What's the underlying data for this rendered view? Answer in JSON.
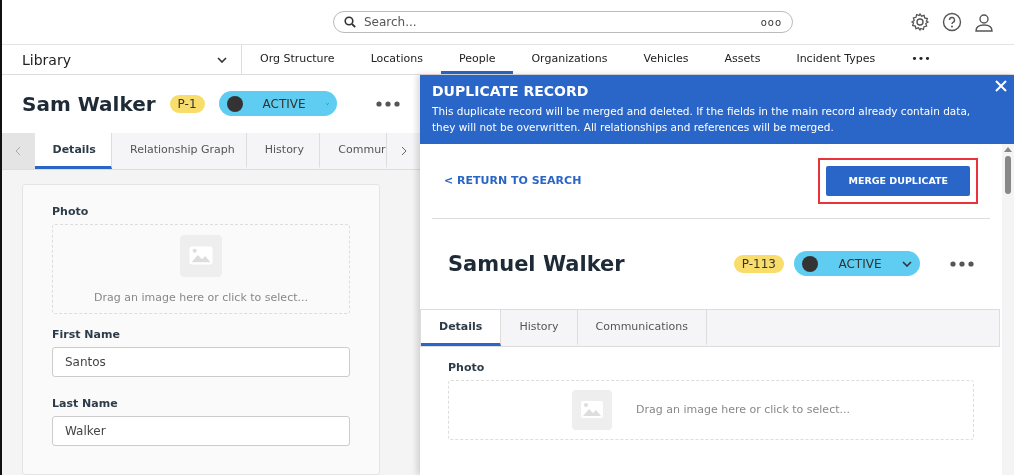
{
  "header": {
    "search": {
      "placeholder": "Search...",
      "more": "ooo"
    }
  },
  "nav": {
    "library": "Library",
    "items": [
      {
        "label": "Org Structure",
        "selected": false
      },
      {
        "label": "Locations",
        "selected": false
      },
      {
        "label": "People",
        "selected": true
      },
      {
        "label": "Organizations",
        "selected": false
      },
      {
        "label": "Vehicles",
        "selected": false
      },
      {
        "label": "Assets",
        "selected": false
      },
      {
        "label": "Incident Types",
        "selected": false
      },
      {
        "label": "•••",
        "selected": false
      }
    ]
  },
  "main_record": {
    "name": "Sam Walker",
    "id": "P-1",
    "status": "ACTIVE",
    "tabs": [
      {
        "label": "Details",
        "selected": true
      },
      {
        "label": "Relationship Graph",
        "selected": false
      },
      {
        "label": "History",
        "selected": false
      },
      {
        "label": "Commur",
        "selected": false
      }
    ],
    "photo": {
      "label": "Photo",
      "hint": "Drag an image here or click to select..."
    },
    "fields": [
      {
        "label": "First Name",
        "value": "Santos"
      },
      {
        "label": "Last Name",
        "value": "Walker"
      }
    ]
  },
  "duplicate_panel": {
    "title": "DUPLICATE RECORD",
    "message": "This duplicate record will be merged and deleted. If the fields in the main record already contain data, they will not be overwritten. All relationships and references will be merged.",
    "return_link": "< RETURN TO SEARCH",
    "merge_button": "MERGE DUPLICATE",
    "record": {
      "name": "Samuel Walker",
      "id": "P-113",
      "status": "ACTIVE",
      "tabs": [
        {
          "label": "Details",
          "selected": true
        },
        {
          "label": "History",
          "selected": false
        },
        {
          "label": "Communications",
          "selected": false
        }
      ],
      "photo": {
        "label": "Photo",
        "hint": "Drag an image here or click to select..."
      }
    }
  }
}
